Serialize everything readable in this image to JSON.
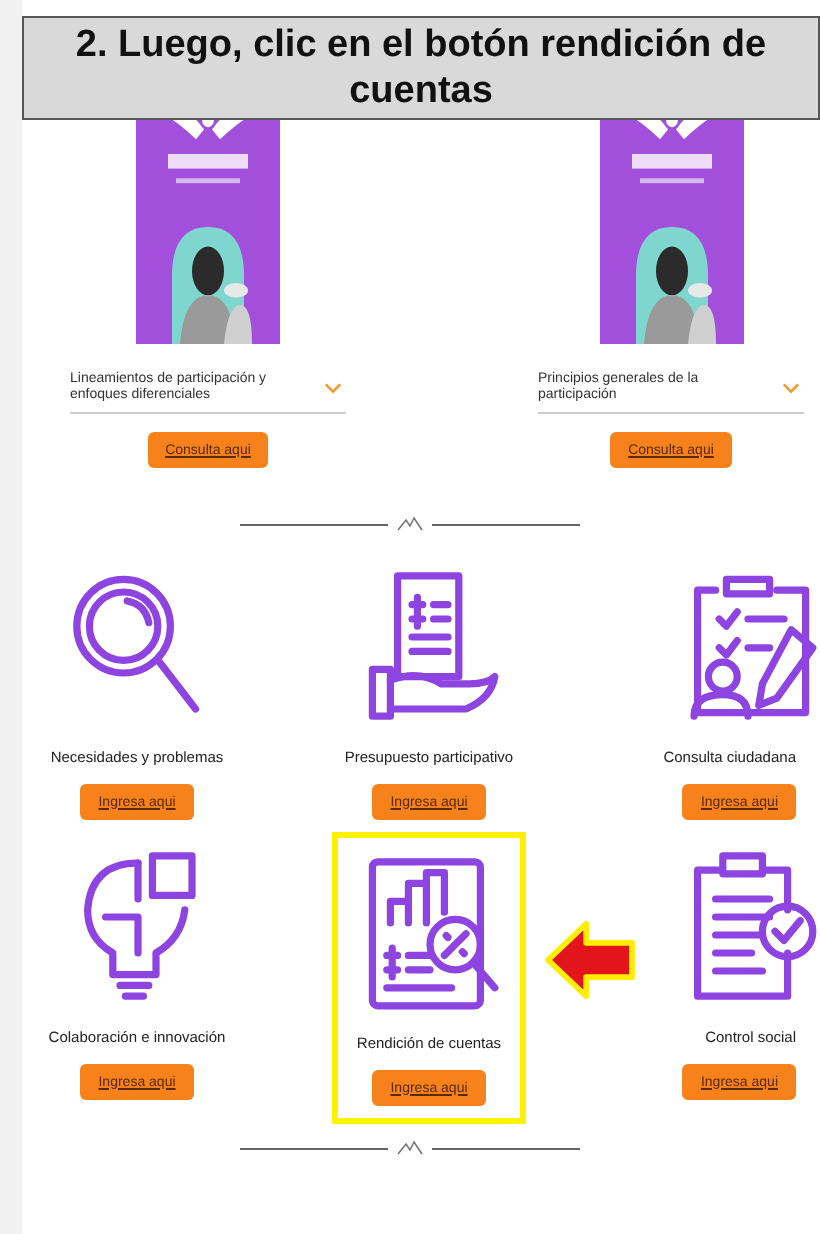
{
  "banner": {
    "text": "2. Luego, clic en el botón rendición de cuentas"
  },
  "documents": [
    {
      "kind": "picture",
      "title": "Lineamientos de participación y enfoques diferenciales",
      "button": "Consulta aqui"
    },
    {
      "kind": "picture",
      "title": "Principios generales de la participación",
      "button": "Consulta aqui"
    }
  ],
  "services": [
    {
      "kind": "magnifier",
      "label": "Necesidades y problemas",
      "button": "Ingresa aqui",
      "highlighted": false
    },
    {
      "kind": "bill-hand",
      "label": "Presupuesto participativo",
      "button": "Ingresa aqui",
      "highlighted": false
    },
    {
      "kind": "clipboard-person",
      "label": "Consulta ciudadana",
      "button": "Ingresa aqui",
      "highlighted": false
    },
    {
      "kind": "bulb-puzzle",
      "label": "Colaboración e innovación",
      "button": "Ingresa aqui",
      "highlighted": false
    },
    {
      "kind": "report-chart",
      "label": "Rendición de cuentas",
      "button": "Ingresa aqui",
      "highlighted": true
    },
    {
      "kind": "clipboard-check",
      "label": "Control social",
      "button": "Ingresa aqui",
      "highlighted": false
    }
  ]
}
